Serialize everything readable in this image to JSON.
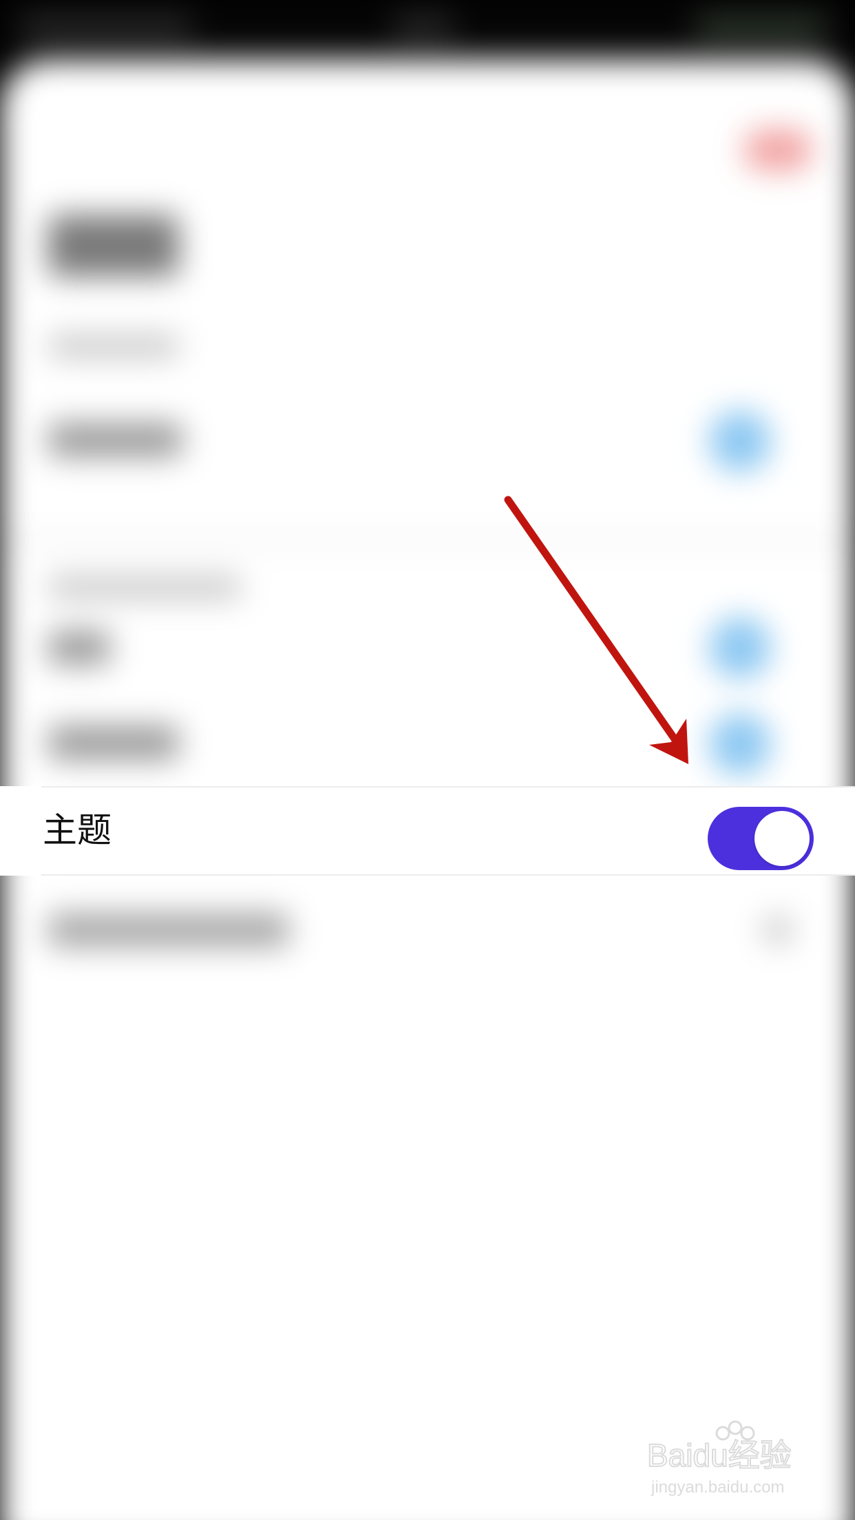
{
  "settings": {
    "theme_row": {
      "label": "主题",
      "toggle_on": true
    }
  },
  "colors": {
    "toggle_on": "#4c30de",
    "annotation_arrow": "#c0150f",
    "blurred_toggles": "#8dc8f2"
  },
  "watermark": {
    "brand": "Baidu经验",
    "url": "jingyan.baidu.com"
  }
}
